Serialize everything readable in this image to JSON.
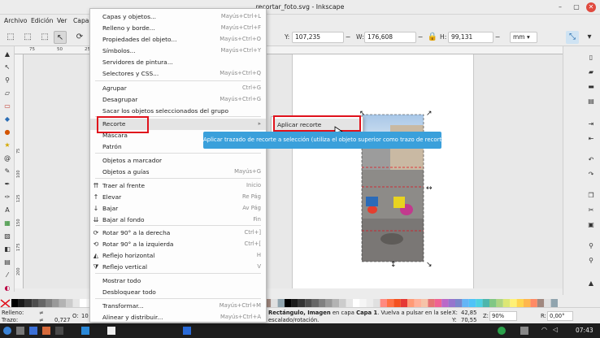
{
  "window": {
    "title": "recortar_foto.svg - Inkscape"
  },
  "menubar": [
    "Archivo",
    "Edición",
    "Ver",
    "Capa"
  ],
  "controls": {
    "x_label": "X:",
    "x_value": "",
    "y_label": "Y:",
    "y_value": "107,235",
    "w_label": "W:",
    "w_value": "176,608",
    "h_label": "H:",
    "h_value": "99,131",
    "unit": "mm"
  },
  "menu": {
    "items": [
      {
        "label": "Capas y objetos...",
        "shortcut": "Mayús+Ctrl+L"
      },
      {
        "label": "Relleno y borde...",
        "shortcut": "Mayús+Ctrl+F"
      },
      {
        "label": "Propiedades del objeto...",
        "shortcut": "Mayús+Ctrl+O"
      },
      {
        "label": "Símbolos...",
        "shortcut": "Mayús+Ctrl+Y"
      },
      {
        "label": "Servidores de pintura...",
        "shortcut": ""
      },
      {
        "label": "Selectores y CSS...",
        "shortcut": "Mayús+Ctrl+Q"
      },
      {
        "label": "Agrupar",
        "shortcut": "Ctrl+G"
      },
      {
        "label": "Desagrupar",
        "shortcut": "Mayús+Ctrl+G"
      },
      {
        "label": "Sacar los objetos seleccionados del grupo",
        "shortcut": ""
      },
      {
        "label": "Recorte",
        "shortcut": "▸"
      },
      {
        "label": "Máscara",
        "shortcut": ""
      },
      {
        "label": "Patrón",
        "shortcut": ""
      },
      {
        "label": "Objetos a marcador",
        "shortcut": ""
      },
      {
        "label": "Objetos a guías",
        "shortcut": "Mayús+G"
      },
      {
        "label": "Traer al frente",
        "shortcut": "Inicio"
      },
      {
        "label": "Elevar",
        "shortcut": "Re Pág"
      },
      {
        "label": "Bajar",
        "shortcut": "Av Pág"
      },
      {
        "label": "Bajar al fondo",
        "shortcut": "Fin"
      },
      {
        "label": "Rotar 90° a la derecha",
        "shortcut": "Ctrl+]"
      },
      {
        "label": "Rotar 90° a la izquierda",
        "shortcut": "Ctrl+["
      },
      {
        "label": "Reflejo horizontal",
        "shortcut": "H"
      },
      {
        "label": "Reflejo vertical",
        "shortcut": "V"
      },
      {
        "label": "Mostrar todo",
        "shortcut": ""
      },
      {
        "label": "Desbloquear todo",
        "shortcut": ""
      },
      {
        "label": "Transformar...",
        "shortcut": "Mayús+Ctrl+M"
      },
      {
        "label": "Alinear y distribuir...",
        "shortcut": "Mayús+Ctrl+A"
      }
    ]
  },
  "submenu": {
    "label": "Aplicar recorte"
  },
  "tooltip": "Aplicar trazado de recorte a selección (utiliza el objeto superior como trazo de recorte)",
  "status": {
    "fill_label": "Relleno:",
    "stroke_label": "Trazo:",
    "stroke_width": "0,727",
    "o_label": "O:",
    "o_value": "10",
    "message_bold": "Rectángulo, Imagen",
    "message_rest": " en capa ",
    "layer": "Capa 1",
    "message_tail": ". Vuelva a pulsar en la selección",
    "message_line2": "escalado/rotación.",
    "x_label": "X:",
    "x_value": "42,85",
    "y_label": "Y:",
    "y_value": "70,55",
    "z_label": "Z:",
    "zoom": "90%",
    "r_label": "R:",
    "rotation": "0,00°"
  },
  "ruler": {
    "h": [
      "75",
      "50",
      "25"
    ],
    "v": [
      "75",
      "100",
      "125",
      "150",
      "175",
      "200"
    ]
  },
  "taskbar": {
    "time": "07:43"
  },
  "colors": {
    "highlight": "#e0121c",
    "accent": "#3aa0db"
  }
}
